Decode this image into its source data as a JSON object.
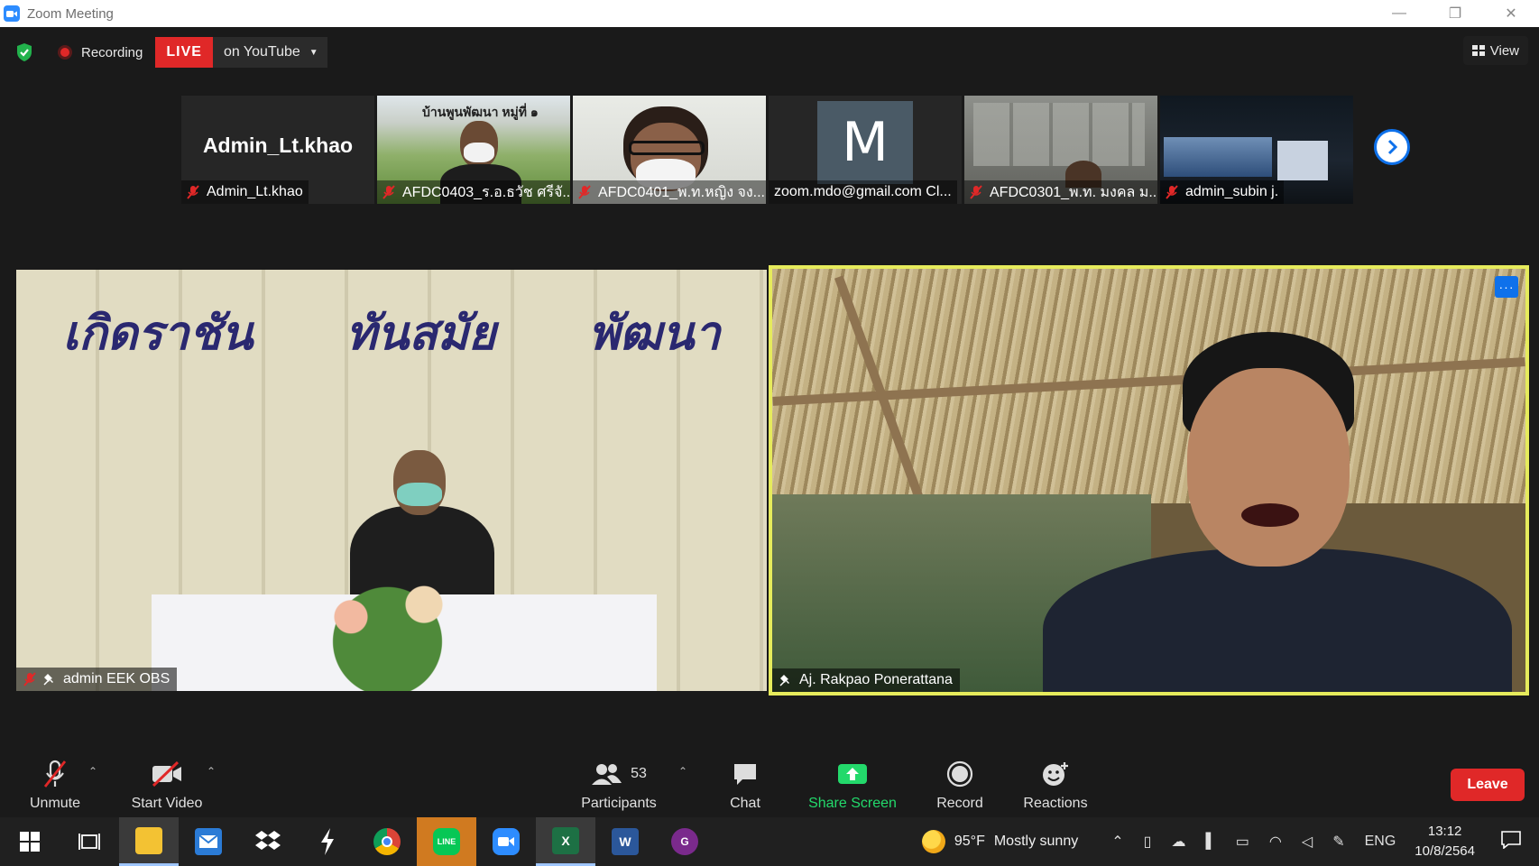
{
  "window": {
    "title": "Zoom Meeting"
  },
  "topbar": {
    "recording_label": "Recording",
    "live_label": "LIVE",
    "live_platform": "on YouTube",
    "view_label": "View"
  },
  "gallery_strip": [
    {
      "name": "Admin_Lt.khao",
      "display": "Admin_Lt.khao",
      "muted": true
    },
    {
      "name": "AFDC0403_ร.อ.ธวัช  ศรีจั...",
      "muted": true,
      "scene_text": "บ้านพูนพัฒนา หมู่ที่ ๑"
    },
    {
      "name": "AFDC0401_พ.ท.หญิง จง...",
      "muted": true
    },
    {
      "name": "zoom.mdo@gmail.com Cl...",
      "avatar_letter": "M",
      "muted": false
    },
    {
      "name": "AFDC0301_พ.ท. มงคล  ม...",
      "muted": true
    },
    {
      "name": "admin_subin j.",
      "muted": true
    }
  ],
  "main_tiles": {
    "left": {
      "name": "admin EEK OBS",
      "banner": [
        "เกิดราชัน",
        "ทันสมัย",
        "พัฒนา"
      ]
    },
    "right": {
      "name": "Aj. Rakpao Ponerattana",
      "more_label": "···"
    }
  },
  "toolbar": {
    "unmute": "Unmute",
    "start_video": "Start Video",
    "participants": "Participants",
    "participants_count": "53",
    "chat": "Chat",
    "share_screen": "Share Screen",
    "record": "Record",
    "reactions": "Reactions",
    "leave": "Leave"
  },
  "taskbar": {
    "weather_temp": "95°F",
    "weather_desc": "Mostly sunny",
    "language": "ENG",
    "time": "13:12",
    "date": "10/8/2564"
  },
  "colors": {
    "accent_blue": "#0e71eb",
    "live_red": "#e02828",
    "share_green": "#23d96b",
    "active_speaker_border": "#e6eb5c"
  }
}
